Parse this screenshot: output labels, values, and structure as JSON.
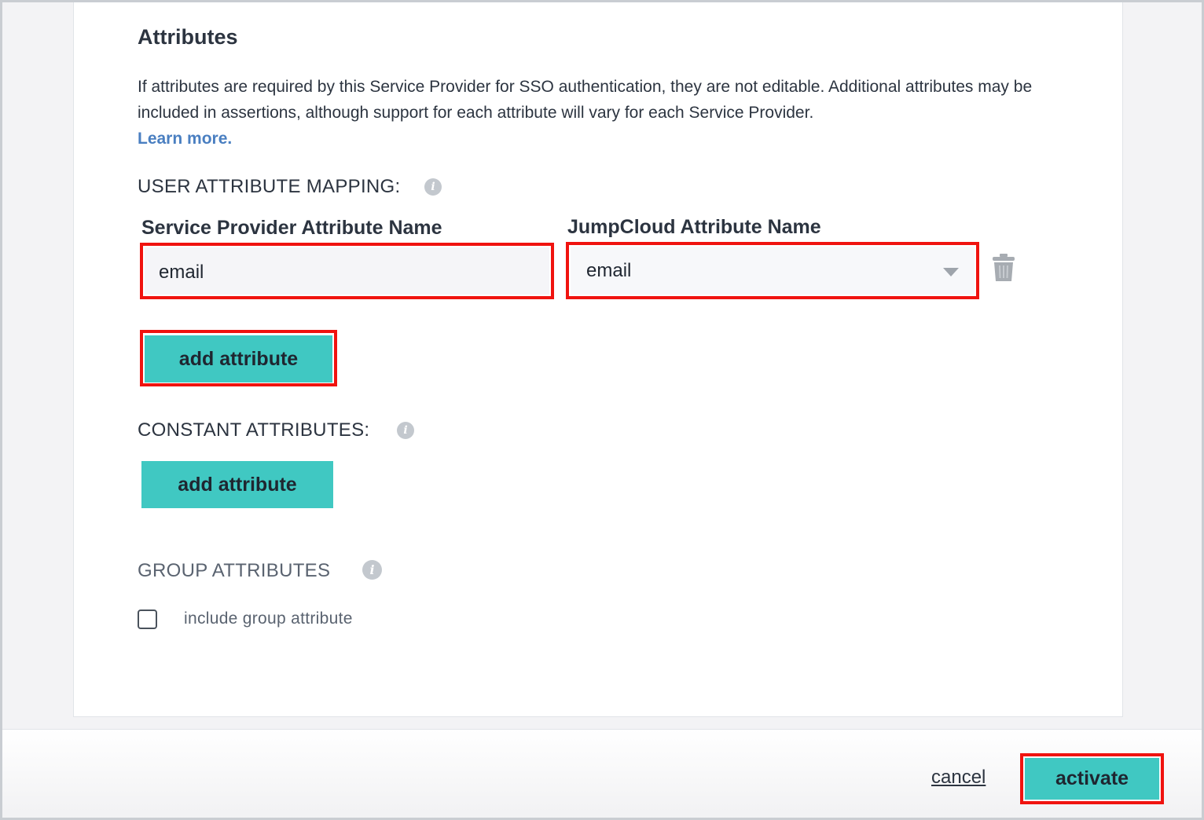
{
  "attributes": {
    "heading": "Attributes",
    "description": "If attributes are required by this Service Provider for SSO authentication, they are not editable. Additional attributes may be included in assertions, although support for each attribute will vary for each Service Provider.",
    "learn_more": "Learn more."
  },
  "user_mapping": {
    "label": "USER ATTRIBUTE MAPPING:",
    "sp_header": "Service Provider Attribute Name",
    "jc_header": "JumpCloud Attribute Name",
    "sp_value": "email",
    "jc_value": "email",
    "add_label": "add attribute"
  },
  "constant": {
    "label": "CONSTANT ATTRIBUTES:",
    "add_label": "add attribute"
  },
  "group": {
    "label": "GROUP ATTRIBUTES",
    "checkbox_label": "include group attribute",
    "checked": false
  },
  "footer": {
    "cancel": "cancel",
    "activate": "activate"
  },
  "colors": {
    "accent": "#40c8c2",
    "highlight": "#f0130f",
    "link": "#4a7fc1"
  }
}
